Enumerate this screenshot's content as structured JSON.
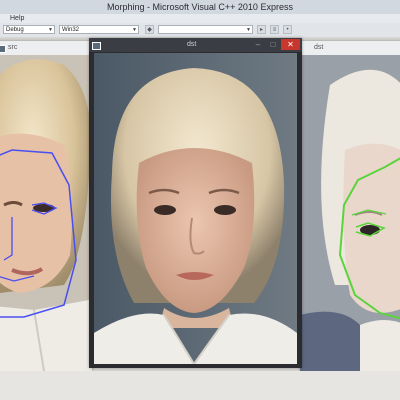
{
  "app": {
    "title": "Morphing - Microsoft Visual C++ 2010 Express",
    "menu": {
      "item_1": "Help"
    }
  },
  "toolbar": {
    "config_combo": "Debug",
    "platform_combo": "Win32"
  },
  "windows": {
    "left": {
      "title": "src"
    },
    "center": {
      "title": "dst",
      "minimize_glyph": "–",
      "maximize_glyph": "□",
      "close_glyph": "✕"
    },
    "right": {
      "title": "dst"
    }
  },
  "colors": {
    "left_landmark_outline": "#4a4ff2",
    "right_landmark_outline": "#5ad43a",
    "close_button": "#c8372d"
  },
  "icons": [
    "window-icon",
    "dropdown-arrow-icon",
    "close-icon",
    "minimize-icon",
    "maximize-icon"
  ]
}
